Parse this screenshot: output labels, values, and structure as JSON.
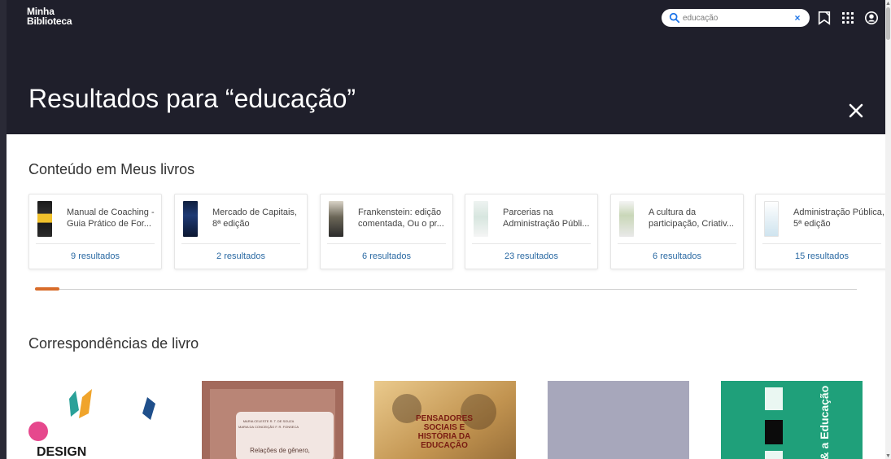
{
  "brand": {
    "line1": "Minha",
    "line2": "Biblioteca"
  },
  "search": {
    "value": "educação",
    "placeholder": "educação"
  },
  "page": {
    "title": "Resultados para “educação”"
  },
  "sections": {
    "my_books_title": "Conteúdo em Meus livros",
    "book_matches_title": "Correspondências de livro"
  },
  "cards": [
    {
      "title": "Manual de Coaching - Guia Prático de For...",
      "results": "9 resultados"
    },
    {
      "title": "Mercado de Capitais, 8ª edição",
      "results": "2 resultados"
    },
    {
      "title": "Frankenstein: edição comentada, Ou o pr...",
      "results": "6 resultados"
    },
    {
      "title": "Parcerias na Administração Públi...",
      "results": "23 resultados"
    },
    {
      "title": "A cultura da participação, Criativ...",
      "results": "6 resultados"
    },
    {
      "title": "Administração Pública, 5ª edição",
      "results": "15 resultados"
    }
  ],
  "book_covers": [
    {
      "text_1": "DESIGN"
    },
    {
      "text_1": "MARIA CELESTE R. T. DE SOUZA",
      "text_2": "MARIA DA CONCEIÇÃO F. R. FONSECA",
      "text_3": "Relações de gênero,"
    },
    {
      "text_1": "PENSADORES",
      "text_2": "SOCIAIS E",
      "text_3": "HISTÓRIA DA",
      "text_4": "EDUCAÇÃO"
    },
    {
      "text_1": ""
    },
    {
      "text_1": "d & a Educação"
    }
  ],
  "icons": {
    "search": "search-icon",
    "clear": "close-icon",
    "bookmark": "bookmark-icon",
    "apps": "apps-grid-icon",
    "account": "account-icon",
    "close": "close-icon"
  },
  "colors": {
    "header_bg": "#1f1f2b",
    "accent_blue": "#2b6aa3",
    "progress_accent": "#d86c2a"
  }
}
